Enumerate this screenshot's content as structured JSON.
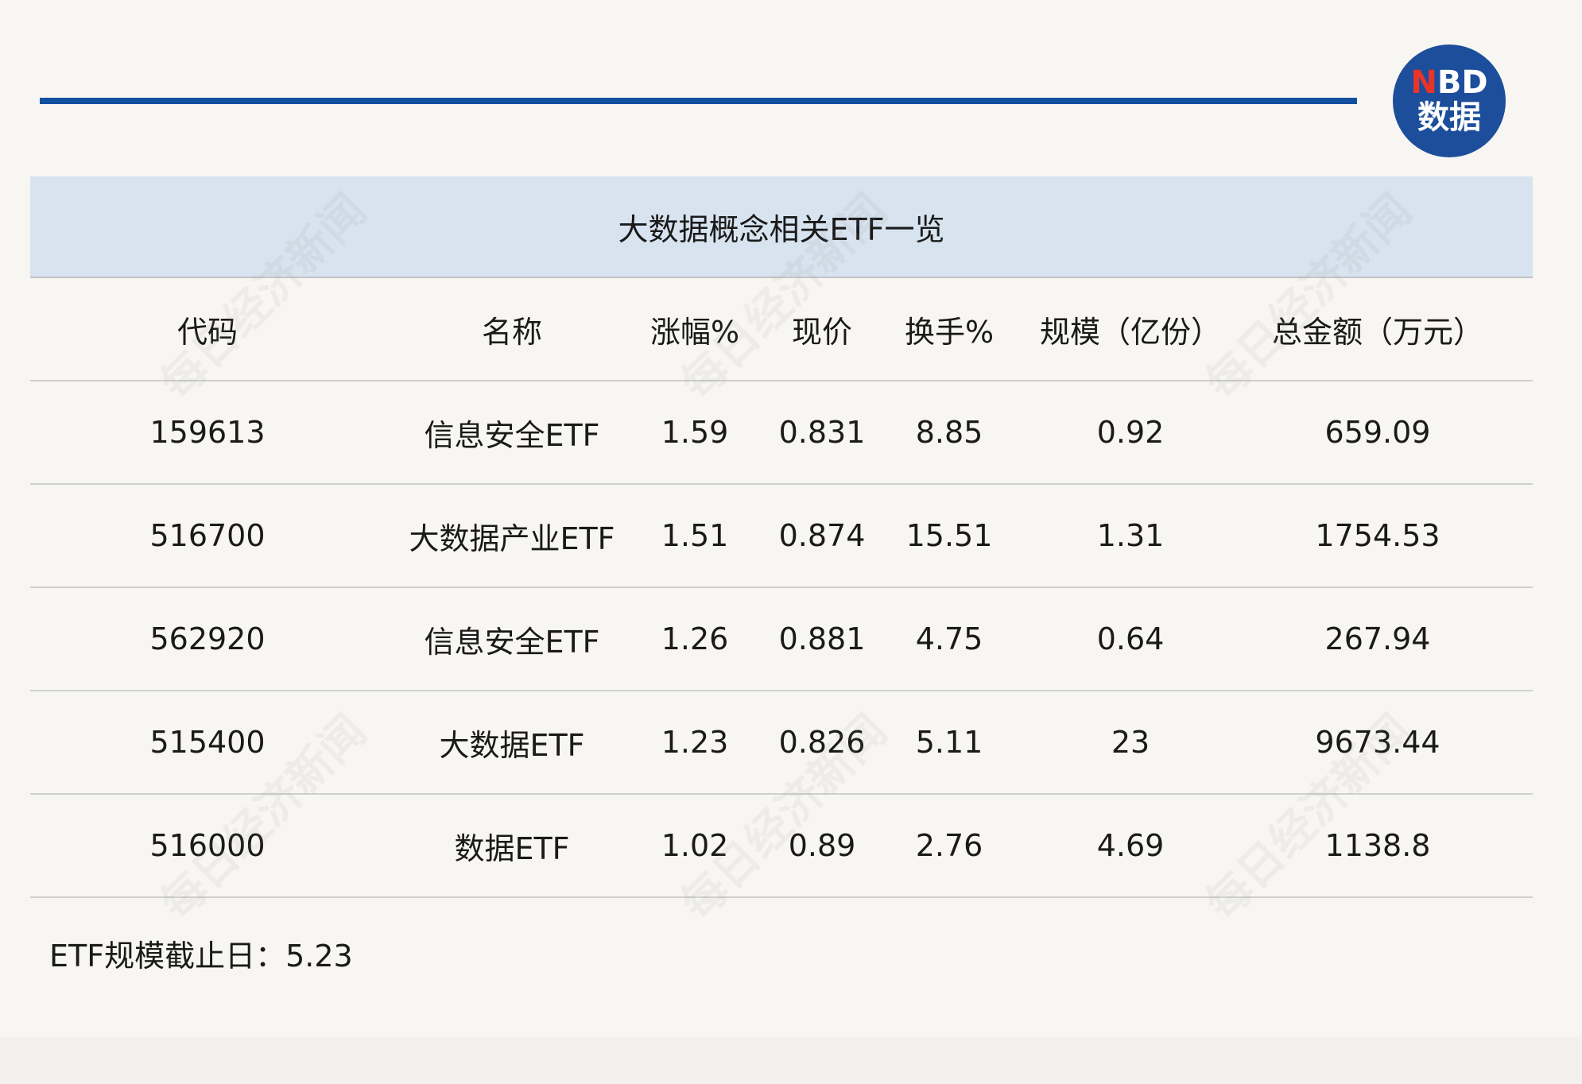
{
  "logo": {
    "line1_prefix": "N",
    "line1_rest": "BD",
    "line2": "数据"
  },
  "table": {
    "title": "大数据概念相关ETF一览",
    "headers": [
      "代码",
      "名称",
      "涨幅%",
      "现价",
      "换手%",
      "规模（亿份）",
      "总金额（万元）"
    ],
    "rows": [
      [
        "159613",
        "信息安全ETF",
        "1.59",
        "0.831",
        "8.85",
        "0.92",
        "659.09"
      ],
      [
        "516700",
        "大数据产业ETF",
        "1.51",
        "0.874",
        "15.51",
        "1.31",
        "1754.53"
      ],
      [
        "562920",
        "信息安全ETF",
        "1.26",
        "0.881",
        "4.75",
        "0.64",
        "267.94"
      ],
      [
        "515400",
        "大数据ETF",
        "1.23",
        "0.826",
        "5.11",
        "23",
        "9673.44"
      ],
      [
        "516000",
        "数据ETF",
        "1.02",
        "0.89",
        "2.76",
        "4.69",
        "1138.8"
      ]
    ]
  },
  "footnote": "ETF规模截止日：5.23",
  "watermark_text": "每日经济新闻",
  "colors": {
    "accent_blue": "#1450a0",
    "title_band": "#d7e3ef",
    "logo_bg": "#1c4e9c",
    "logo_red": "#e8342a"
  }
}
